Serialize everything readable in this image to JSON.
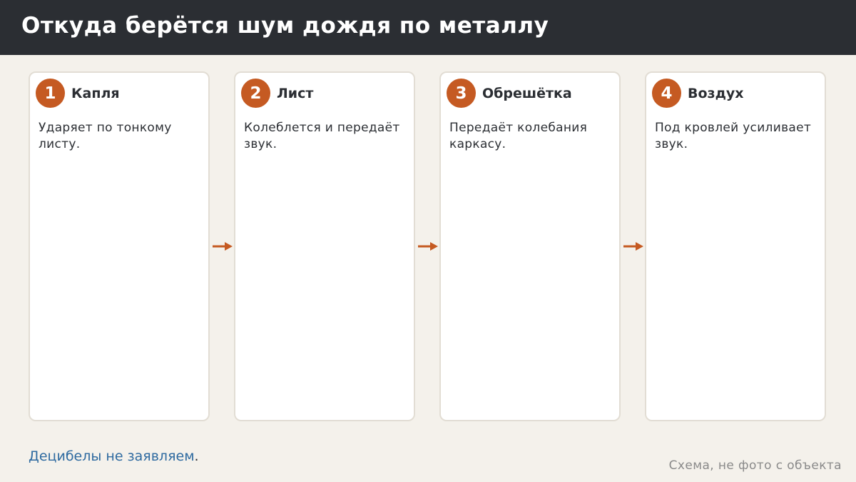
{
  "header": {
    "title": "Откуда берётся шум дождя по металлу"
  },
  "steps": [
    {
      "number": "1",
      "title": "Капля",
      "description": "Ударяет по тонкому листу."
    },
    {
      "number": "2",
      "title": "Лист",
      "description": "Колеблется и передаёт звук."
    },
    {
      "number": "3",
      "title": "Обрешётка",
      "description": "Передаёт колебания каркасу."
    },
    {
      "number": "4",
      "title": "Воздух",
      "description": "Под кровлей усиливает звук."
    }
  ],
  "footer": {
    "note": "Децибелы не заявляем",
    "note_end": ".",
    "caption": "Схема, не фото с объекта"
  },
  "colors": {
    "header_bg": "#2b2e33",
    "accent": "#c55a22",
    "link": "#2e6aa0",
    "background": "#f4f1eb"
  },
  "icons": {
    "connector": "arrow-right-icon"
  }
}
